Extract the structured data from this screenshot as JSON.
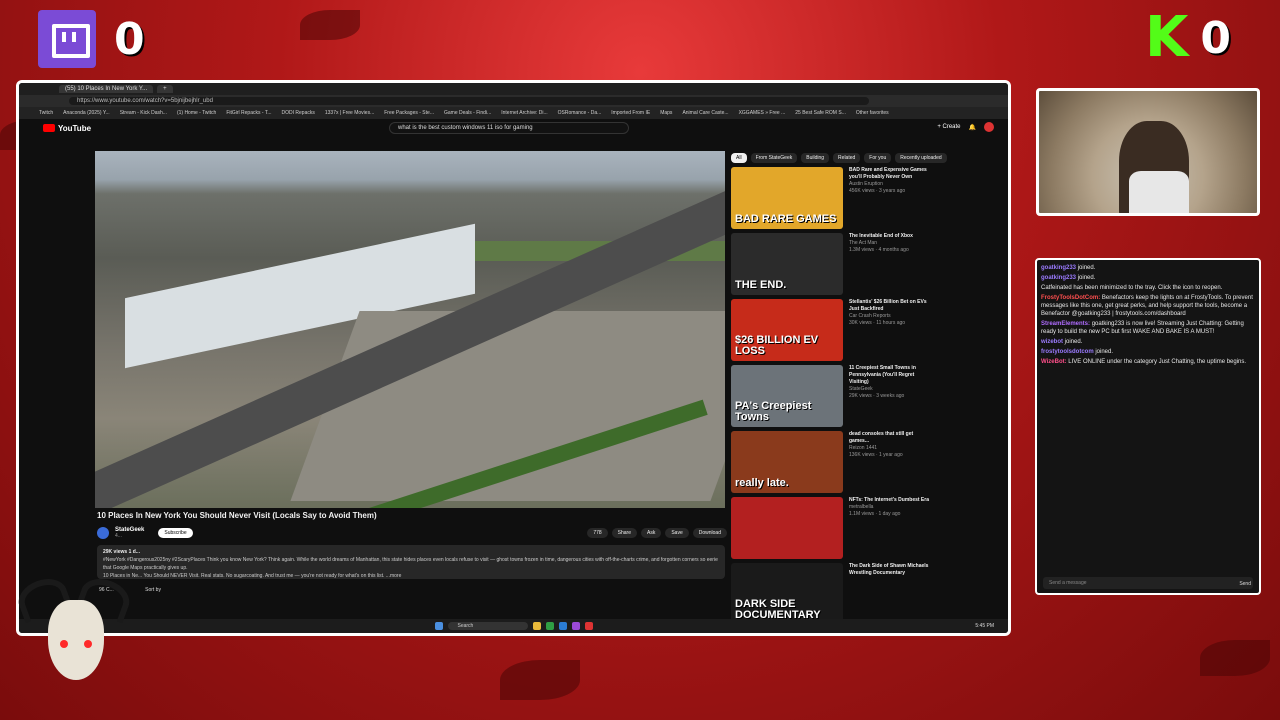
{
  "scoreboard": {
    "twitch_score": "0",
    "kick_score": "0",
    "kick_letter": "K"
  },
  "browser": {
    "active_tab": "(55) 10 Places In New York Y...",
    "address": "https://www.youtube.com/watch?v=5bjnijbejhlr_ubd",
    "bookmarks": [
      "Twitch",
      "Anaconda (2025) Y...",
      "Stream - Kick Dash...",
      "(1) Home - Twitch",
      "FitGirl Repacks - T...",
      "DODI Repacks",
      "1337x | Free Movies...",
      "Free Packages - Ste...",
      "Game Deals - Findi...",
      "Internet Archive: Di...",
      "OSRomance - Da...",
      "Imported From IE",
      "Maps",
      "Animal Care Caste...",
      "XGGAMES » Free ...",
      "25 Best Safe ROM S...",
      "Other favorites"
    ]
  },
  "youtube": {
    "logo_text": "YouTube",
    "search_value": "what is the best custom windows 11 iso for gaming",
    "create_label": "+ Create",
    "video_title": "10 Places In New York You Should Never Visit (Locals Say to Avoid Them)",
    "channel": {
      "name": "StateGeek",
      "subs": "4...",
      "subscribe_label": "Subscribe"
    },
    "actions": [
      "778",
      "Share",
      "Ask",
      "Save",
      "Download"
    ],
    "description": {
      "stats": "29K views 1 d...",
      "line1": "#NewYork #Dangerous2025ny #2ScaryPlaces Think you know New York? Think again. While the world dreams of Manhattan, this state hides places even locals refuse to visit — ghost towns frozen in time, dangerous cities with off-the-charts crime, and forgotten corners so eerie that Google Maps practically gives up.",
      "line2": "10 Places in Ne... You Should NEVER Visit. Real stats. No sugarcoating. And trust me — you're not ready for what's on this list. ...more"
    },
    "comments_count": "96 C...",
    "sort_label": "Sort by",
    "chips": [
      "All",
      "From StateGeek",
      "Building",
      "Related",
      "For you",
      "Recently uploaded"
    ],
    "recommendations": [
      {
        "thumb": "BAD RARE GAMES",
        "title": "BAD Rare and Expensive Games you'll Probably Never Own",
        "channel": "Austin Eruption",
        "meta": "456K views · 3 years ago",
        "color": "#e2a72a"
      },
      {
        "thumb": "THE END.",
        "title": "The Inevitable End of Xbox",
        "channel": "The Act Man",
        "meta": "1.3M views · 4 months ago",
        "color": "#2b2b2b"
      },
      {
        "thumb": "$26 BILLION EV LOSS",
        "title": "Stellantis' $26 Billion Bet on EVs Just Backfired",
        "channel": "Car Crash Reports",
        "meta": "30K views · 11 hours ago",
        "color": "#c62b1a"
      },
      {
        "thumb": "PA's Creepiest Towns",
        "title": "11 Creepiest Small Towns in Pennsylvania (You'll Regret Visiting)",
        "channel": "StateGeek",
        "meta": "29K views · 3 weeks ago",
        "color": "#6c7379"
      },
      {
        "thumb": "really late.",
        "title": "dead consoles that still get games...",
        "channel": "Reizon 1441",
        "meta": "136K views · 1 year ago",
        "color": "#8a3a1c"
      },
      {
        "thumb": "",
        "title": "NFTs: The Internet's Dumbest Era",
        "channel": "metralbella",
        "meta": "1.1M views · 1 day ago",
        "color": "#b32020"
      },
      {
        "thumb": "DARK SIDE DOCUMENTARY",
        "title": "The Dark Side of Shawn Michaels Wrestling Documentary",
        "channel": "",
        "meta": "",
        "color": "#1a1a1a"
      }
    ]
  },
  "taskbar": {
    "search_placeholder": "Search",
    "time": "5:45 PM"
  },
  "chat": {
    "messages": [
      {
        "user": "goatking233",
        "text": "joined.",
        "color": "#9b7bff"
      },
      {
        "user": "goatking233",
        "text": "joined.",
        "color": "#9b7bff"
      },
      {
        "user": "",
        "text": "Catfeinated has been minimized to the tray. Click the icon to reopen.",
        "color": "#ff5a5a"
      },
      {
        "user": "FrostyToolsDotCom:",
        "text": "Benefactors keep the lights on at FrostyTools. To prevent messages like this one, get great perks, and help support the tools, become a Benefactor @goatking233 | frostytools.com/dashboard",
        "color": "#ff4f4f"
      },
      {
        "user": "StreamElements:",
        "text": "goatking233 is now live! Streaming Just Chatting: Getting ready to build the new PC but first WAKE AND BAKE IS A MUST!",
        "color": "#b06cff"
      },
      {
        "user": "wizebot",
        "text": "joined.",
        "color": "#9b7bff"
      },
      {
        "user": "frostytoolsdotcom",
        "text": "joined.",
        "color": "#9b7bff"
      },
      {
        "user": "WizeBot:",
        "text": "LIVE ONLINE under the category Just Chatting, the uptime begins.",
        "color": "#ff4f8a"
      }
    ],
    "input_placeholder": "Send a message",
    "send_label": "Send"
  }
}
